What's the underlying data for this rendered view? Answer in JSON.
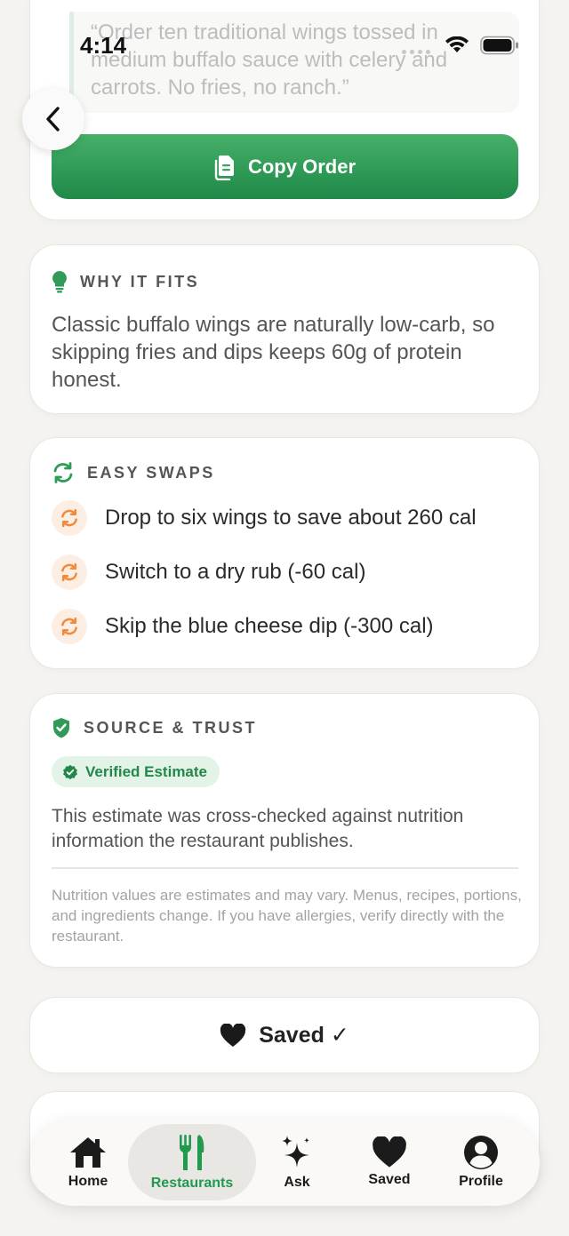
{
  "status_bar": {
    "time": "4:14"
  },
  "order": {
    "quote": "“Order ten traditional wings tossed in medium buffalo sauce with celery and carrots. No fries, no ranch.”",
    "copy_label": "Copy Order"
  },
  "why": {
    "title": "WHY IT FITS",
    "text": "Classic buffalo wings are naturally low-carb, so skipping fries and dips keeps 60g of protein honest."
  },
  "swaps": {
    "title": "EASY SWAPS",
    "items": [
      "Drop to six wings to save about 260 cal",
      "Switch to a dry rub (-60 cal)",
      "Skip the blue cheese dip (-300 cal)"
    ]
  },
  "source": {
    "title": "SOURCE & TRUST",
    "badge": "Verified Estimate",
    "description": "This estimate was cross-checked against nutrition information the restaurant publishes.",
    "disclaimer": "Nutrition values are estimates and may vary. Menus, recipes, portions, and ingredients change. If you have allergies, verify directly with the restaurant."
  },
  "saved_button": {
    "label": "Saved ✓"
  },
  "tabs": [
    {
      "label": "Home",
      "icon": "house-icon"
    },
    {
      "label": "Restaurants",
      "icon": "fork-knife-icon",
      "active": true
    },
    {
      "label": "Ask",
      "icon": "sparkles-icon"
    },
    {
      "label": "Saved",
      "icon": "heart-icon"
    },
    {
      "label": "Profile",
      "icon": "person-circle-icon"
    }
  ],
  "colors": {
    "accent_green": "#2f9b56",
    "swap_orange": "#f08a3c",
    "background": "#f4f3f0"
  }
}
